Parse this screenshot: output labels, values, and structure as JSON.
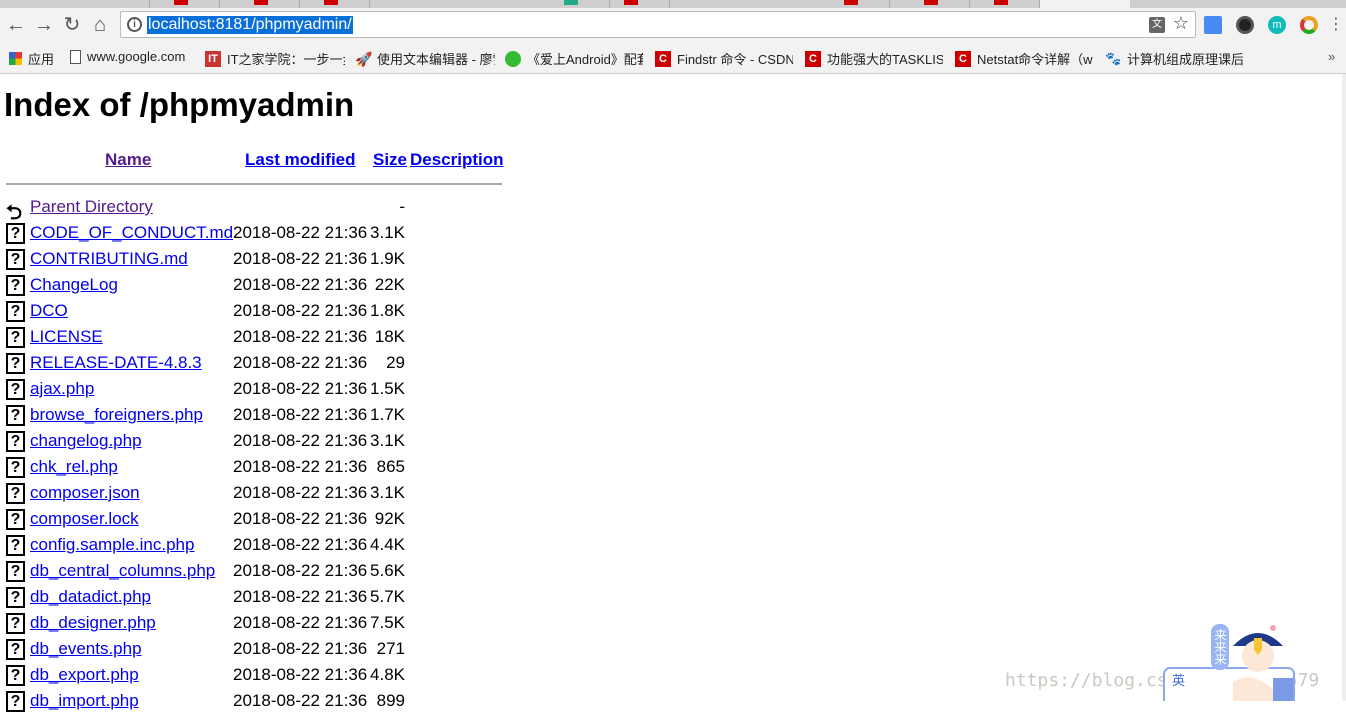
{
  "browser": {
    "url": "localhost:8181/phpmyadmin/",
    "bookmarks": [
      {
        "label": "应用",
        "icon": "apps-grid-icon"
      },
      {
        "label": "www.google.com",
        "icon": "page-icon"
      },
      {
        "label": "IT之家学院：一步一步",
        "icon": "ithome-icon"
      },
      {
        "label": "使用文本编辑器 - 廖雪",
        "icon": "rocket-icon"
      },
      {
        "label": "《爱上Android》配套",
        "icon": "wechat-icon"
      },
      {
        "label": "Findstr 命令 - CSDN",
        "icon": "csdn-icon"
      },
      {
        "label": "功能强大的TASKLIST",
        "icon": "csdn-icon"
      },
      {
        "label": "Netstat命令详解（w",
        "icon": "csdn-icon"
      },
      {
        "label": "计算机组成原理课后习",
        "icon": "baidu-paw-icon"
      }
    ],
    "more": "»"
  },
  "page": {
    "title": "Index of /phpmyadmin",
    "headers": {
      "name": "Name",
      "modified": "Last modified",
      "size": "Size",
      "description": "Description"
    },
    "rows": [
      {
        "name": "Parent Directory",
        "date": "",
        "size": "-",
        "icon": "back-arrow-icon"
      },
      {
        "name": "CODE_OF_CONDUCT.md",
        "date": "2018-08-22 21:36",
        "size": "3.1K"
      },
      {
        "name": "CONTRIBUTING.md",
        "date": "2018-08-22 21:36",
        "size": "1.9K"
      },
      {
        "name": "ChangeLog",
        "date": "2018-08-22 21:36",
        "size": "22K"
      },
      {
        "name": "DCO",
        "date": "2018-08-22 21:36",
        "size": "1.8K"
      },
      {
        "name": "LICENSE",
        "date": "2018-08-22 21:36",
        "size": "18K"
      },
      {
        "name": "RELEASE-DATE-4.8.3",
        "date": "2018-08-22 21:36",
        "size": "29"
      },
      {
        "name": "ajax.php",
        "date": "2018-08-22 21:36",
        "size": "1.5K"
      },
      {
        "name": "browse_foreigners.php",
        "date": "2018-08-22 21:36",
        "size": "1.7K"
      },
      {
        "name": "changelog.php",
        "date": "2018-08-22 21:36",
        "size": "3.1K"
      },
      {
        "name": "chk_rel.php",
        "date": "2018-08-22 21:36",
        "size": "865"
      },
      {
        "name": "composer.json",
        "date": "2018-08-22 21:36",
        "size": "3.1K"
      },
      {
        "name": "composer.lock",
        "date": "2018-08-22 21:36",
        "size": "92K"
      },
      {
        "name": "config.sample.inc.php",
        "date": "2018-08-22 21:36",
        "size": "4.4K"
      },
      {
        "name": "db_central_columns.php",
        "date": "2018-08-22 21:36",
        "size": "5.6K"
      },
      {
        "name": "db_datadict.php",
        "date": "2018-08-22 21:36",
        "size": "5.7K"
      },
      {
        "name": "db_designer.php",
        "date": "2018-08-22 21:36",
        "size": "7.5K"
      },
      {
        "name": "db_events.php",
        "date": "2018-08-22 21:36",
        "size": "271"
      },
      {
        "name": "db_export.php",
        "date": "2018-08-22 21:36",
        "size": "4.8K"
      },
      {
        "name": "db_import.php",
        "date": "2018-08-22 21:36",
        "size": "899"
      }
    ],
    "file_icon": "unknown-file-icon"
  },
  "watermark": "https://blog.csdn.net/        777579",
  "mascot": {
    "badge": "来来来",
    "lang": "英"
  }
}
